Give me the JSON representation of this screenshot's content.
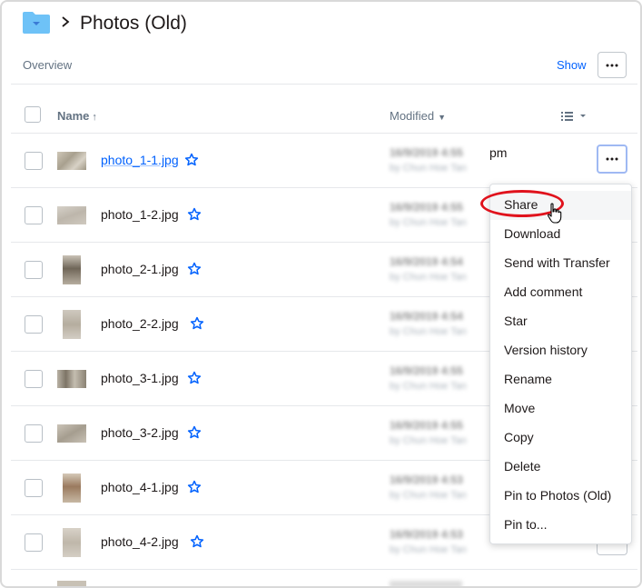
{
  "breadcrumb": {
    "title": "Photos (Old)"
  },
  "toolbar": {
    "overview_label": "Overview",
    "show_label": "Show"
  },
  "table": {
    "headers": {
      "name": "Name",
      "modified": "Modified"
    },
    "rows": [
      {
        "name": "photo_1-1.jpg",
        "modified_time": "16/9/2019 4:55",
        "modified_by": "by Chun Hoe Tan"
      },
      {
        "name": "photo_1-2.jpg",
        "modified_time": "16/9/2019 4:55",
        "modified_by": "by Chun Hoe Tan"
      },
      {
        "name": "photo_2-1.jpg",
        "modified_time": "16/9/2019 4:54",
        "modified_by": "by Chun Hoe Tan"
      },
      {
        "name": "photo_2-2.jpg",
        "modified_time": "16/9/2019 4:54",
        "modified_by": "by Chun Hoe Tan"
      },
      {
        "name": "photo_3-1.jpg",
        "modified_time": "16/9/2019 4:55",
        "modified_by": "by Chun Hoe Tan"
      },
      {
        "name": "photo_3-2.jpg",
        "modified_time": "16/9/2019 4:55",
        "modified_by": "by Chun Hoe Tan"
      },
      {
        "name": "photo_4-1.jpg",
        "modified_time": "16/9/2019 4:53",
        "modified_by": "by Chun Hoe Tan"
      },
      {
        "name": "photo_4-2.jpg",
        "modified_time": "16/9/2019 4:53",
        "modified_by": "by Chun Hoe Tan"
      }
    ],
    "first_row_time_suffix": "pm"
  },
  "context_menu": {
    "items": [
      "Share",
      "Download",
      "Send with Transfer",
      "Add comment",
      "Star",
      "Version history",
      "Rename",
      "Move",
      "Copy",
      "Delete",
      "Pin to Photos (Old)",
      "Pin to..."
    ]
  },
  "colors": {
    "accent": "#0061fe",
    "highlight": "#e0121c",
    "folder": "#6ec2f7"
  },
  "icons": [
    "folder-icon",
    "chevron-right-icon",
    "more-icon",
    "sort-arrow-icon",
    "list-view-icon",
    "star-icon",
    "hand-cursor-icon"
  ]
}
